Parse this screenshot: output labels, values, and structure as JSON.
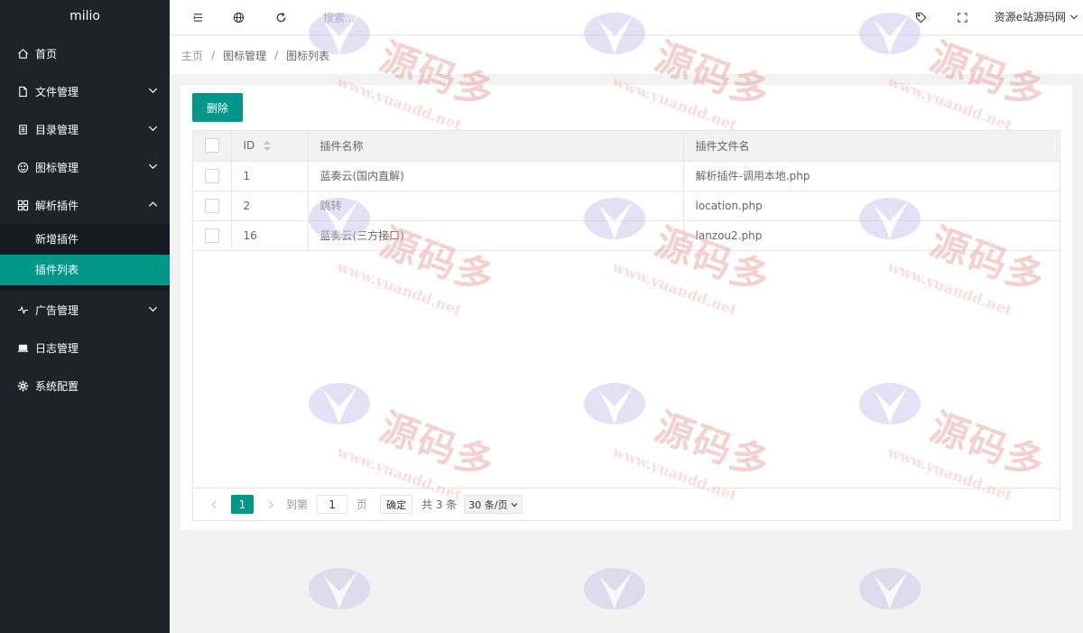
{
  "sidebar": {
    "logo": "milio",
    "items": [
      {
        "label": "首页",
        "icon": "home-icon"
      },
      {
        "label": "文件管理",
        "icon": "file-icon"
      },
      {
        "label": "目录管理",
        "icon": "list-icon"
      },
      {
        "label": "图标管理",
        "icon": "smile-icon"
      },
      {
        "label": "解析插件",
        "icon": "app-icon"
      },
      {
        "label": "广告管理",
        "icon": "pulse-icon"
      },
      {
        "label": "日志管理",
        "icon": "monitor-icon"
      },
      {
        "label": "系统配置",
        "icon": "gear-icon"
      }
    ],
    "submenu": [
      {
        "label": "新增插件"
      },
      {
        "label": "插件列表"
      }
    ]
  },
  "header": {
    "search_placeholder": "搜索...",
    "user": "资源e站源码网"
  },
  "breadcrumb": {
    "home": "主页",
    "section": "图标管理",
    "current": "图标列表",
    "separator": "/"
  },
  "toolbar": {
    "delete_label": "删除"
  },
  "table": {
    "columns": [
      "ID",
      "插件名称",
      "插件文件名"
    ],
    "rows": [
      {
        "id": "1",
        "name": "蓝奏云(国内直解)",
        "file": "解析插件-调用本地.php"
      },
      {
        "id": "2",
        "name": "跳转",
        "file": "location.php"
      },
      {
        "id": "16",
        "name": "蓝奏云(三方接口)",
        "file": "lanzou2.php"
      }
    ]
  },
  "pagination": {
    "current": "1",
    "goto_label": "到第",
    "page_input": "1",
    "page_suffix": "页",
    "confirm": "确定",
    "total": "共 3 条",
    "page_size": "30 条/页"
  },
  "watermark": {
    "cn": "源码多",
    "en": "www.yuandd.net"
  },
  "colors": {
    "accent": "#009688",
    "sidebar": "#20222a",
    "submenu": "#181a20"
  }
}
